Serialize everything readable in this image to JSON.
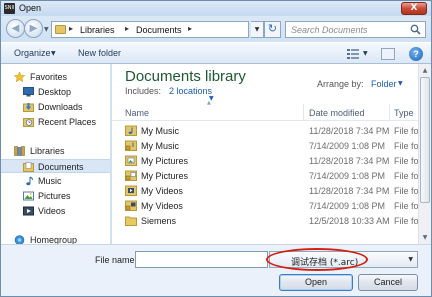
{
  "window": {
    "title": "Open",
    "app_icon_text": "SNII",
    "close_label": "X"
  },
  "address": {
    "breadcrumb": [
      "Libraries",
      "Documents"
    ],
    "separator": "▸",
    "search_placeholder": "Search Documents"
  },
  "toolbar": {
    "organize": "Organize",
    "new_folder": "New folder",
    "help": "?"
  },
  "nav": {
    "favorites": "Favorites",
    "favorites_items": [
      "Desktop",
      "Downloads",
      "Recent Places"
    ],
    "libraries": "Libraries",
    "libraries_items": [
      "Documents",
      "Music",
      "Pictures",
      "Videos"
    ],
    "homegroup": "Homegroup"
  },
  "content": {
    "library_title": "Documents library",
    "includes_label": "Includes:",
    "includes_link": "2 locations",
    "arrange_label": "Arrange by:",
    "arrange_value": "Folder",
    "columns": [
      "Name",
      "Date modified",
      "Type"
    ],
    "files": [
      {
        "name": "My Music",
        "date": "11/28/2018 7:34 PM",
        "type": "File fol",
        "icon": "music-folder-icon"
      },
      {
        "name": "My Music",
        "date": "7/14/2009 1:08 PM",
        "type": "File fol",
        "icon": "music-folder-locked-icon"
      },
      {
        "name": "My Pictures",
        "date": "11/28/2018 7:34 PM",
        "type": "File fol",
        "icon": "pictures-folder-icon"
      },
      {
        "name": "My Pictures",
        "date": "7/14/2009 1:08 PM",
        "type": "File fol",
        "icon": "pictures-folder-locked-icon"
      },
      {
        "name": "My Videos",
        "date": "11/28/2018 7:34 PM",
        "type": "File fol",
        "icon": "videos-folder-icon"
      },
      {
        "name": "My Videos",
        "date": "7/14/2009 1:08 PM",
        "type": "File fol",
        "icon": "videos-folder-locked-icon"
      },
      {
        "name": "Siemens",
        "date": "12/5/2018 10:33 AM",
        "type": "File fol",
        "icon": "folder-icon"
      }
    ]
  },
  "footer": {
    "file_name_label": "File name:",
    "file_name_value": "",
    "file_type_value": "调试存档 (*.arc)",
    "open": "Open",
    "cancel": "Cancel"
  },
  "colors": {
    "title_green": "#1e5a30",
    "link_blue": "#1a5bb5",
    "highlight_red": "#d32011",
    "selection": "#d9e6f5"
  }
}
